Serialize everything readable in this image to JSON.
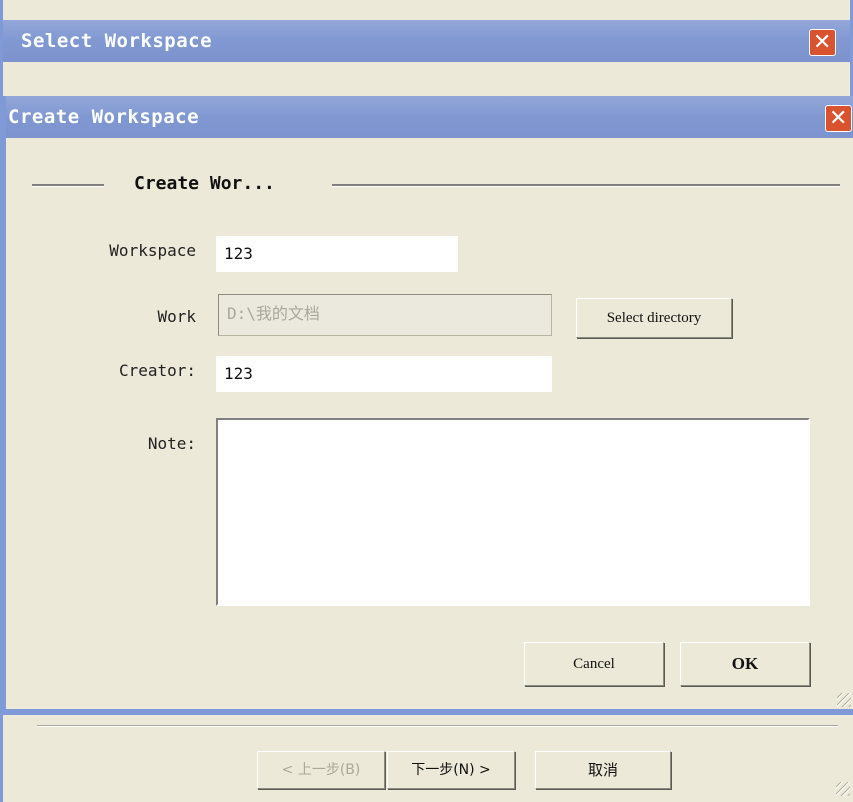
{
  "outer_window": {
    "title": "Select Workspace",
    "close_glyph": "✕"
  },
  "dialog": {
    "title": "Create Workspace",
    "close_glyph": "✕",
    "group_title": "Create Wor...",
    "fields": {
      "workspace": {
        "label": "Workspace",
        "value": "123"
      },
      "work": {
        "label": "Work",
        "value": "D:\\我的文档"
      },
      "creator": {
        "label": "Creator:",
        "value": "123"
      },
      "note": {
        "label": "Note:",
        "value": ""
      }
    },
    "buttons": {
      "select_directory": "Select directory",
      "cancel": "Cancel",
      "ok": "OK"
    }
  },
  "wizard": {
    "back_label": "< 上一步(B)",
    "next_label": "下一步(N) >",
    "cancel_label": "取消"
  },
  "colors": {
    "titlebar": "#8098d2",
    "close": "#d9542e",
    "face": "#ece9d8"
  }
}
